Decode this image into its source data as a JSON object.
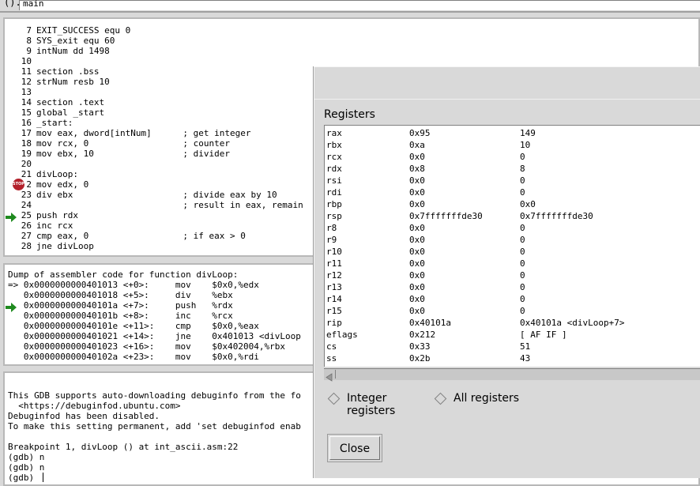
{
  "topbar": {
    "paren_label": "().",
    "expression_value": "main"
  },
  "source": {
    "lines": [
      {
        "num": "7",
        "text": "EXIT_SUCCESS equ 0"
      },
      {
        "num": "8",
        "text": "SYS_exit equ 60"
      },
      {
        "num": "9",
        "text": "intNum dd 1498"
      },
      {
        "num": "10",
        "text": ""
      },
      {
        "num": "11",
        "text": "section .bss"
      },
      {
        "num": "12",
        "text": "strNum resb 10"
      },
      {
        "num": "13",
        "text": ""
      },
      {
        "num": "14",
        "text": "section .text"
      },
      {
        "num": "15",
        "text": "global _start"
      },
      {
        "num": "16",
        "text": "_start:"
      },
      {
        "num": "17",
        "text": "mov eax, dword[intNum]      ; get integer"
      },
      {
        "num": "18",
        "text": "mov rcx, 0                  ; counter"
      },
      {
        "num": "19",
        "text": "mov ebx, 10                 ; divider"
      },
      {
        "num": "20",
        "text": ""
      },
      {
        "num": "21",
        "text": "divLoop:"
      },
      {
        "num": "2",
        "text": "mov edx, 0"
      },
      {
        "num": "23",
        "text": "div ebx                     ; divide eax by 10"
      },
      {
        "num": "24",
        "text": "                            ; result in eax, remain"
      },
      {
        "num": "25",
        "text": "push rdx"
      },
      {
        "num": "26",
        "text": "inc rcx"
      },
      {
        "num": "27",
        "text": "cmp eax, 0                  ; if eax > 0"
      },
      {
        "num": "28",
        "text": "jne divLoop"
      }
    ],
    "breakpoint_label": "STOP"
  },
  "asm": {
    "header": "Dump of assembler code for function divLoop:",
    "lines": [
      "=> 0x0000000000401013 <+0>:     mov    $0x0,%edx",
      "   0x0000000000401018 <+5>:     div    %ebx",
      "   0x000000000040101a <+7>:     push   %rdx",
      "   0x000000000040101b <+8>:     inc    %rcx",
      "   0x000000000040101e <+11>:    cmp    $0x0,%eax",
      "   0x0000000000401021 <+14>:    jne    0x401013 <divLoop",
      "   0x0000000000401023 <+16>:    mov    $0x402004,%rbx",
      "   0x000000000040102a <+23>:    mov    $0x0,%rdi"
    ]
  },
  "console": {
    "lines": [
      "",
      "This GDB supports auto-downloading debuginfo from the fo",
      "  <https://debuginfod.ubuntu.com>",
      "Debuginfod has been disabled.",
      "To make this setting permanent, add 'set debuginfod enab",
      "",
      "Breakpoint 1, divLoop () at int_ascii.asm:22",
      "(gdb) n",
      "(gdb) n",
      "(gdb) "
    ]
  },
  "registers_dialog": {
    "title": "Registers",
    "rows": [
      {
        "name": "rax",
        "hex": "0x95",
        "natural": "149"
      },
      {
        "name": "rbx",
        "hex": "0xa",
        "natural": "10"
      },
      {
        "name": "rcx",
        "hex": "0x0",
        "natural": "0"
      },
      {
        "name": "rdx",
        "hex": "0x8",
        "natural": "8"
      },
      {
        "name": "rsi",
        "hex": "0x0",
        "natural": "0"
      },
      {
        "name": "rdi",
        "hex": "0x0",
        "natural": "0"
      },
      {
        "name": "rbp",
        "hex": "0x0",
        "natural": "0x0"
      },
      {
        "name": "rsp",
        "hex": "0x7fffffffde30",
        "natural": "0x7fffffffde30"
      },
      {
        "name": "r8",
        "hex": "0x0",
        "natural": "0"
      },
      {
        "name": "r9",
        "hex": "0x0",
        "natural": "0"
      },
      {
        "name": "r10",
        "hex": "0x0",
        "natural": "0"
      },
      {
        "name": "r11",
        "hex": "0x0",
        "natural": "0"
      },
      {
        "name": "r12",
        "hex": "0x0",
        "natural": "0"
      },
      {
        "name": "r13",
        "hex": "0x0",
        "natural": "0"
      },
      {
        "name": "r14",
        "hex": "0x0",
        "natural": "0"
      },
      {
        "name": "r15",
        "hex": "0x0",
        "natural": "0"
      },
      {
        "name": "rip",
        "hex": "0x40101a",
        "natural": "0x40101a <divLoop+7>"
      },
      {
        "name": "eflags",
        "hex": "0x212",
        "natural": "[ AF IF ]"
      },
      {
        "name": "cs",
        "hex": "0x33",
        "natural": "51"
      },
      {
        "name": "ss",
        "hex": "0x2b",
        "natural": "43"
      }
    ],
    "radio_integer": "Integer registers",
    "radio_all": "All registers",
    "close_label": "Close"
  },
  "colors": {
    "arrow_green": "#1f8a1f",
    "breakpoint_red": "#b3212b"
  }
}
